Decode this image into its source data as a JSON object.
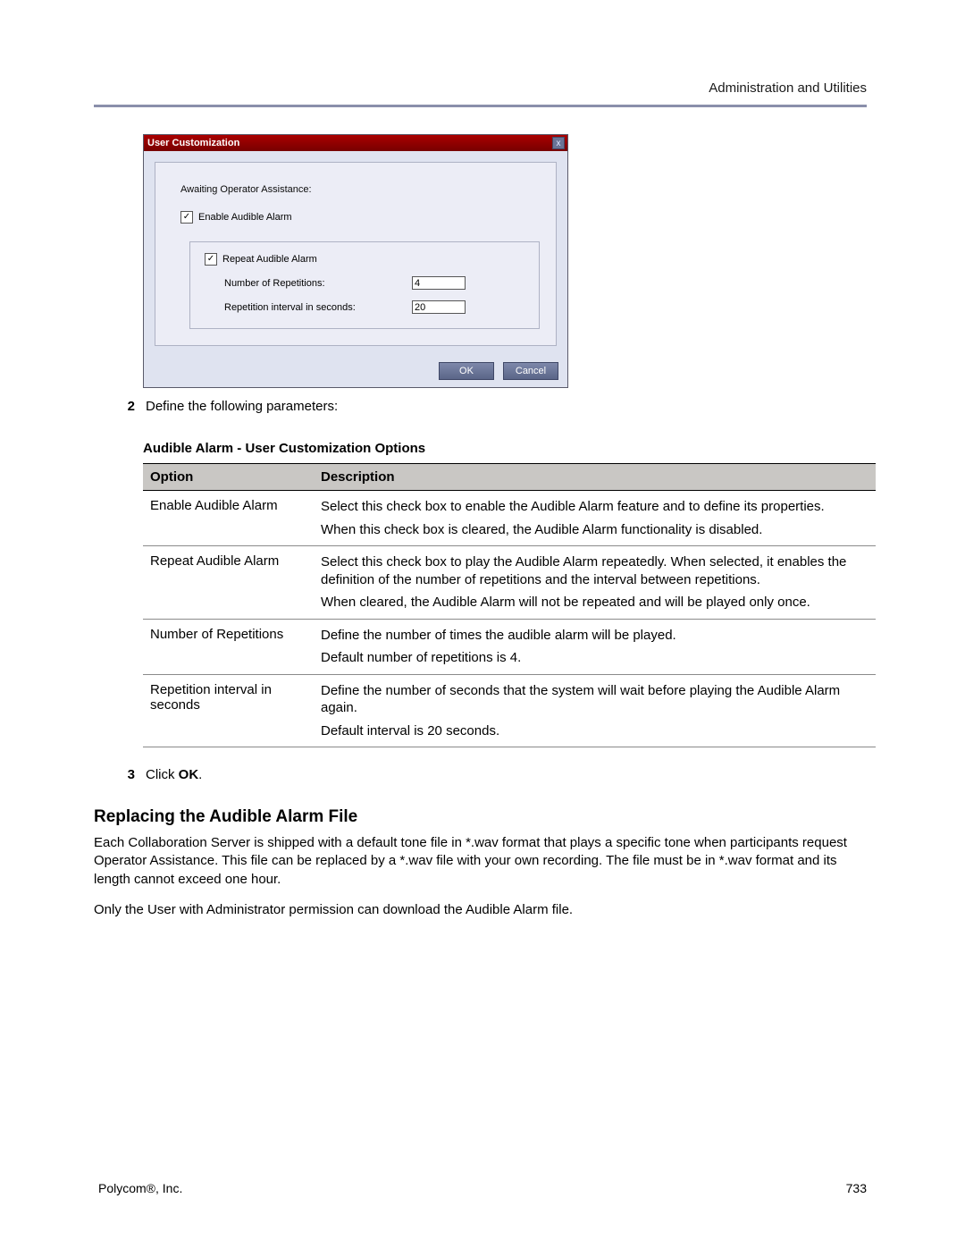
{
  "header": {
    "right": "Administration and Utilities"
  },
  "dialog": {
    "title": "User Customization",
    "awaiting_label": "Awaiting Operator Assistance:",
    "enable_label": "Enable Audible Alarm",
    "repeat_label": "Repeat Audible Alarm",
    "num_rep_label": "Number of Repetitions:",
    "interval_label": "Repetition interval in seconds:",
    "num_rep_value": "4",
    "interval_value": "20",
    "ok": "OK",
    "cancel": "Cancel",
    "close": "x"
  },
  "steps": {
    "two_num": "2",
    "two_text": "Define the following parameters:",
    "three_num": "3",
    "three_prefix": "Click ",
    "three_bold": "OK",
    "three_suffix": "."
  },
  "table": {
    "title": "Audible Alarm - User Customization Options",
    "col_option": "Option",
    "col_desc": "Description",
    "rows": [
      {
        "option": "Enable Audible Alarm",
        "p1": "Select this check box to enable the Audible Alarm feature and to define its properties.",
        "p2": "When this check box is cleared, the Audible Alarm functionality is disabled."
      },
      {
        "option": "Repeat Audible Alarm",
        "p1": "Select this check box to play the Audible Alarm repeatedly. When selected, it enables the definition of the number of repetitions and the interval between repetitions.",
        "p2": "When cleared, the Audible Alarm will not be repeated and will be played only once."
      },
      {
        "option": "Number of Repetitions",
        "p1": "Define the number of times the audible alarm will be played.",
        "p2": "Default number of repetitions is 4."
      },
      {
        "option": "Repetition interval in seconds",
        "p1": "Define the number of seconds that the system will wait before playing the Audible Alarm again.",
        "p2": "Default interval is 20 seconds."
      }
    ]
  },
  "section": {
    "title": "Replacing the Audible Alarm File",
    "p1": "Each Collaboration Server is shipped with a default tone file in *.wav format that plays a specific tone when participants request Operator Assistance. This file can be replaced by a *.wav file with your own recording. The file must be in *.wav format and its length cannot exceed one hour.",
    "p2": "Only the User with Administrator permission can download the Audible Alarm file."
  },
  "footer": {
    "left": "Polycom®, Inc.",
    "right": "733"
  }
}
